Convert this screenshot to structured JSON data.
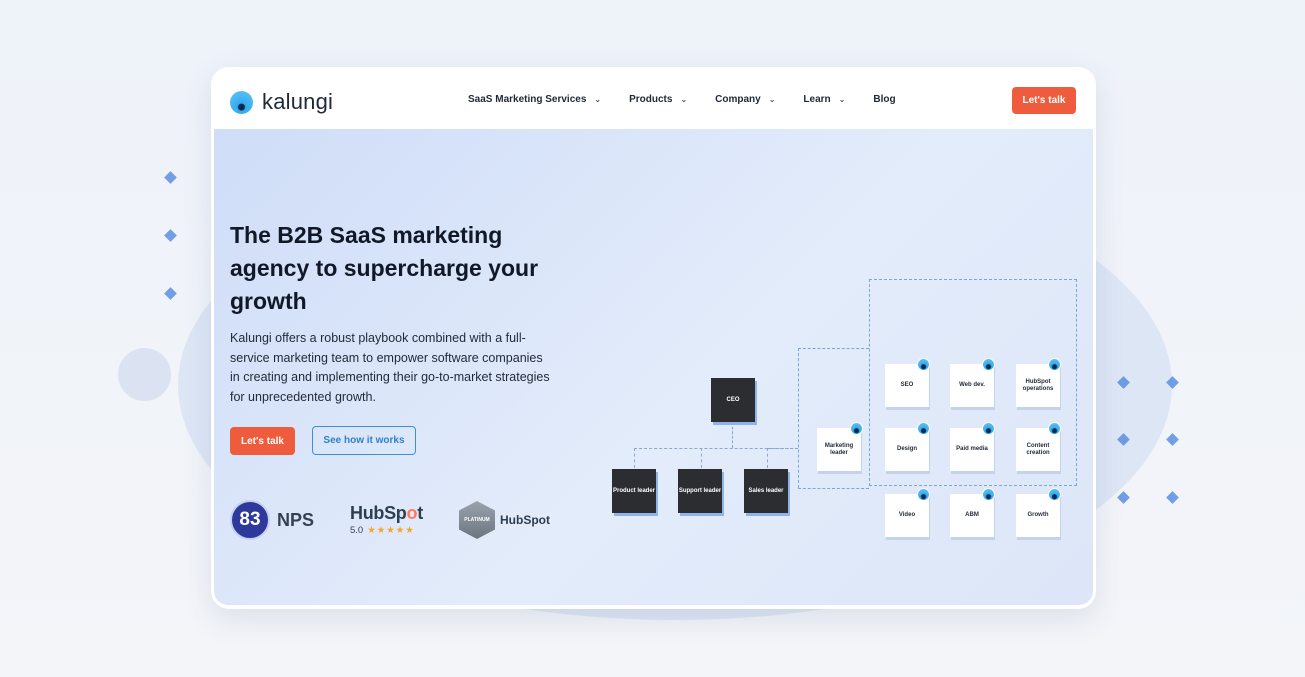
{
  "nav": {
    "brand": "kalungi",
    "menu": [
      {
        "label": "SaaS Marketing Services",
        "has_dropdown": true
      },
      {
        "label": "Products",
        "has_dropdown": true
      },
      {
        "label": "Company",
        "has_dropdown": true
      },
      {
        "label": "Learn",
        "has_dropdown": true
      },
      {
        "label": "Blog",
        "has_dropdown": false
      }
    ],
    "cta_label": "Let's talk"
  },
  "hero": {
    "headline": "The B2B SaaS marketing agency to supercharge your growth",
    "subtext": "Kalungi offers a robust playbook combined with a full-service marketing team to empower software companies in creating and implementing their go-to-market strategies for unprecedented growth.",
    "primary_button": "Let's talk",
    "secondary_button": "See how it works"
  },
  "badges": {
    "nps_score": "83",
    "nps_label": "NPS",
    "hubspot_prefix": "HubSp",
    "hubspot_o": "o",
    "hubspot_suffix": "t",
    "hubspot_rating": "5.0",
    "stars": "★★★★★",
    "platinum_text": "PLATINUM",
    "hubspot_partner": "HubSpot"
  },
  "org_chart": {
    "ceo": "CEO",
    "leaders": [
      "Product leader",
      "Support leader",
      "Sales leader"
    ],
    "marketing_leader": "Marketing leader",
    "team": [
      "SEO",
      "Web dev.",
      "HubSpot operations",
      "Design",
      "Paid media",
      "Content creation",
      "Video",
      "ABM",
      "Growth"
    ]
  },
  "colors": {
    "accent": "#ef5b3d",
    "secondary": "#3d8fd9",
    "dark_box": "#2b2d31"
  }
}
